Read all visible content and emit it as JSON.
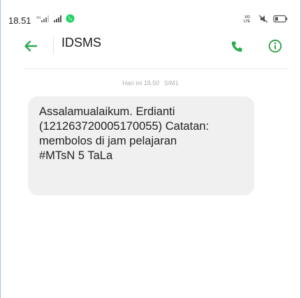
{
  "status_bar": {
    "time": "18.51",
    "icons_left": [
      "signal-icon",
      "signal-icon",
      "whatsapp-icon"
    ],
    "icons_right": [
      "volte-icon",
      "mute-icon",
      "battery-icon"
    ],
    "whatsapp_color": "#25d366"
  },
  "app_bar": {
    "title": "IDSMS",
    "accent_color": "#2eaa4f",
    "info_color": "#2f9e44",
    "icons": [
      "arrow-left-icon",
      "phone-icon",
      "info-icon"
    ]
  },
  "conversation": {
    "timestamp": {
      "date_time": "Hari ini 18.50",
      "sim": "SIM1"
    },
    "messages": [
      {
        "lines": [
          "Assalamualaikum. Erdianti",
          "(121263720005170055) Catatan:",
          "membolos di jam pelajaran",
          "#MTsN 5 TaLa"
        ]
      }
    ]
  }
}
